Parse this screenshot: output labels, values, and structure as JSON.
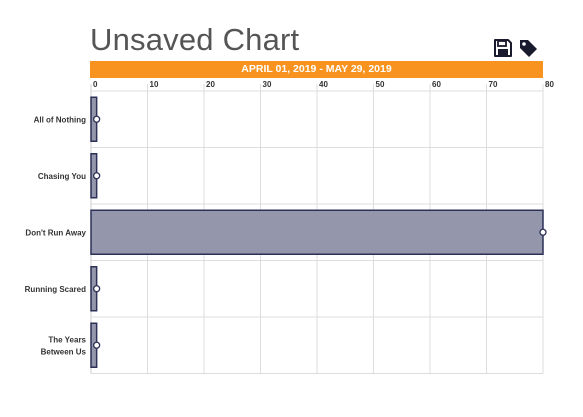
{
  "header": {
    "title": "Unsaved Chart",
    "date_range": "APRIL 01, 2019 - MAY 29, 2019",
    "banner_color": "#f7931e",
    "icons": [
      "save-icon",
      "tag-icon"
    ]
  },
  "chart_data": {
    "type": "bar",
    "orientation": "horizontal",
    "categories": [
      "All of Nothing",
      "Chasing You",
      "Don't Run Away",
      "Running Scared",
      "The Years Between Us"
    ],
    "values": [
      1,
      1,
      80,
      1,
      1
    ],
    "xlim": [
      0,
      80
    ],
    "xticks": [
      0,
      10,
      20,
      30,
      40,
      50,
      60,
      70,
      80
    ],
    "grid": true,
    "bar_fill": "#9497ab",
    "bar_stroke": "#2d3057",
    "grid_color": "#dddddd"
  }
}
